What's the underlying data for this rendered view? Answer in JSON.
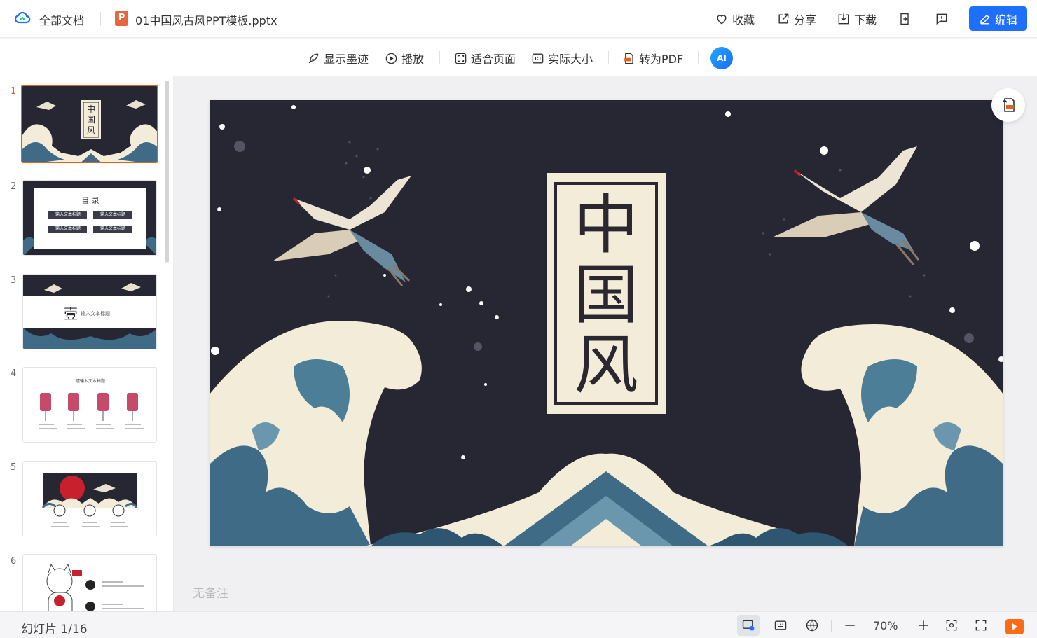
{
  "header": {
    "all_docs": "全部文档",
    "file_icon_letter": "P",
    "file_name": "01中国风古风PPT模板.pptx",
    "favorite": "收藏",
    "share": "分享",
    "download": "下载",
    "edit": "编辑"
  },
  "toolbar": {
    "show_ink": "显示墨迹",
    "play": "播放",
    "fit_page": "适合页面",
    "actual_size": "实际大小",
    "to_pdf": "转为PDF",
    "ai": "AI"
  },
  "thumbnails": [
    {
      "num": "1",
      "title_lines": [
        "中",
        "国",
        "风"
      ]
    },
    {
      "num": "2",
      "title": "目 录",
      "items": [
        "输入文本标题",
        "输入文本标题",
        "输入文本标题",
        "输入文本标题"
      ]
    },
    {
      "num": "3",
      "big": "壹",
      "sub": "输入文本标题"
    },
    {
      "num": "4",
      "title": "请输入文本标题"
    },
    {
      "num": "5"
    },
    {
      "num": "6"
    }
  ],
  "slide": {
    "title_chars": [
      "中",
      "国",
      "风"
    ]
  },
  "notes": "无备注",
  "footer": {
    "slide_count": "幻灯片 1/16",
    "zoom": "70%"
  },
  "colors": {
    "accent": "#1f6fff",
    "active": "#e2611c",
    "slide_bg": "#272633",
    "cream": "#f3ecd9",
    "wave": "#3f6b86"
  }
}
